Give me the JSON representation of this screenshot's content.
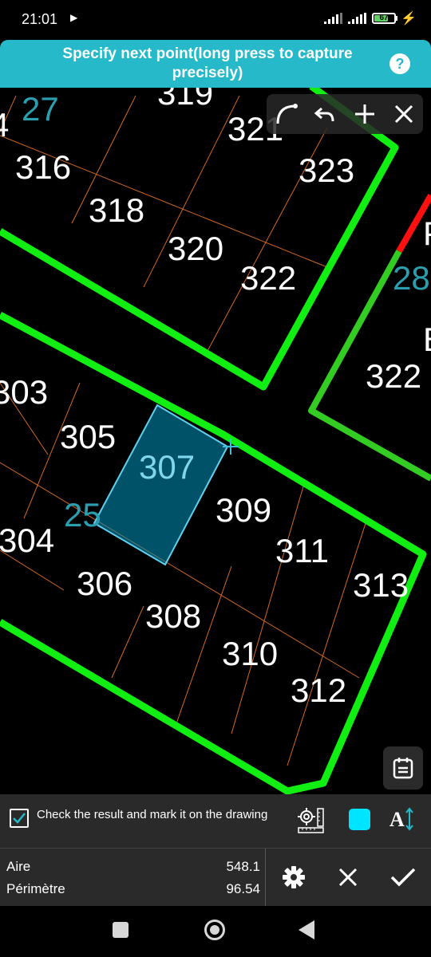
{
  "status_bar": {
    "time": "21:01",
    "battery": "67"
  },
  "prompt": {
    "text": "Specify next point(long press to capture precisely)",
    "help": "?"
  },
  "drawing": {
    "parcel_labels": [
      "319",
      "321",
      "323",
      "316",
      "318",
      "320",
      "322",
      "303",
      "305",
      "307",
      "309",
      "311",
      "313",
      "304",
      "306",
      "308",
      "310",
      "312",
      "322",
      "P",
      "E"
    ],
    "block_labels": [
      "27",
      "28",
      "25"
    ],
    "partial_labels": [
      "4"
    ]
  },
  "options": {
    "check_label": "Check the result and mark it on the drawing",
    "text_size_icon": "A",
    "color": "#00e5ff"
  },
  "results": {
    "area_label": "Aire",
    "area_value": "548.1",
    "perimeter_label": "Périmètre",
    "perimeter_value": "96.54"
  },
  "colors": {
    "accent": "#25b9c9",
    "boundary": "#00ff00",
    "grid": "#d2691e",
    "selection": "#00e5ff"
  }
}
